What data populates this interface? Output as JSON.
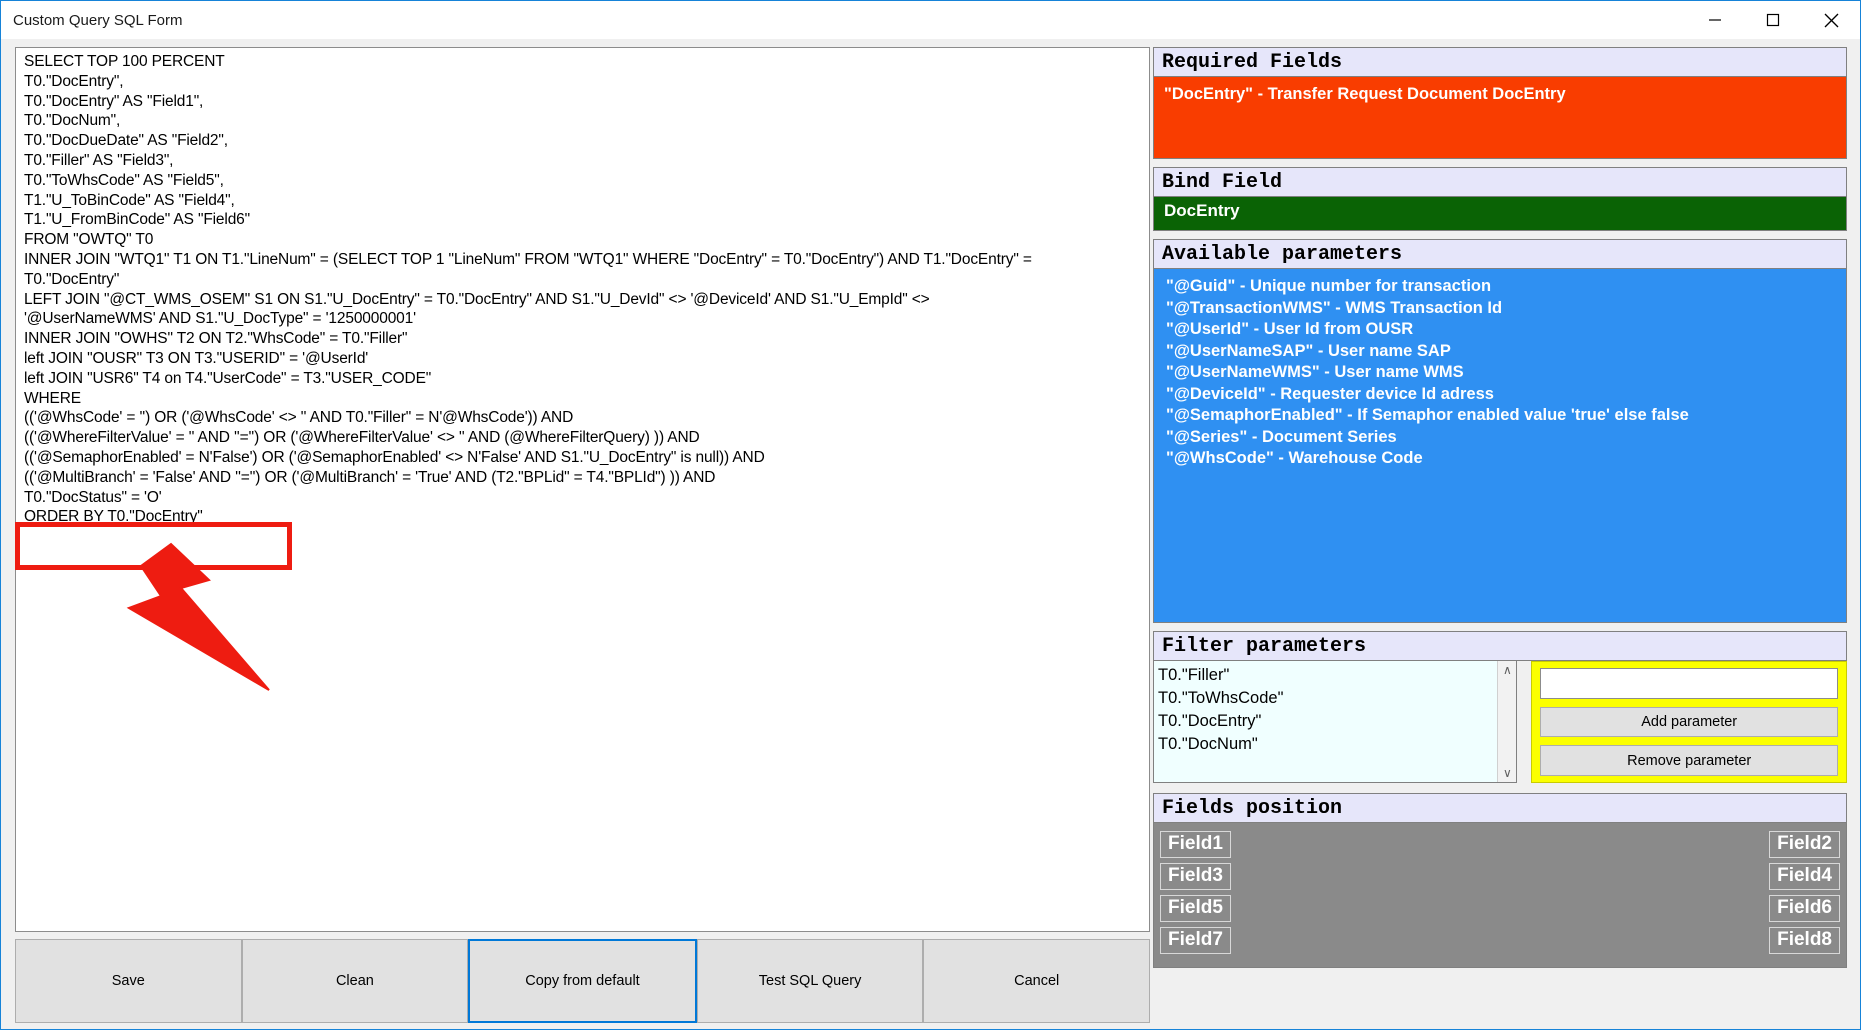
{
  "window": {
    "title": "Custom Query SQL Form",
    "controls": {
      "minimize": "minimize-button",
      "maximize": "maximize-button",
      "close": "close-button"
    }
  },
  "editor": {
    "sql": "SELECT TOP 100 PERCENT\nT0.\"DocEntry\",\nT0.\"DocEntry\" AS \"Field1\",\nT0.\"DocNum\",\nT0.\"DocDueDate\" AS \"Field2\",\nT0.\"Filler\" AS \"Field3\",\nT0.\"ToWhsCode\" AS \"Field5\",\nT1.\"U_ToBinCode\" AS \"Field4\",\nT1.\"U_FromBinCode\" AS \"Field6\"\nFROM \"OWTQ\" T0\nINNER JOIN \"WTQ1\" T1 ON T1.\"LineNum\" = (SELECT TOP 1 \"LineNum\" FROM \"WTQ1\" WHERE \"DocEntry\" = T0.\"DocEntry\") AND T1.\"DocEntry\" =\nT0.\"DocEntry\"\nLEFT JOIN \"@CT_WMS_OSEM\" S1 ON S1.\"U_DocEntry\" = T0.\"DocEntry\" AND S1.\"U_DevId\" <> '@DeviceId' AND S1.\"U_EmpId\" <>\n'@UserNameWMS' AND S1.\"U_DocType\" = '1250000001'\nINNER JOIN \"OWHS\" T2 ON T2.\"WhsCode\" = T0.\"Filler\"\nleft JOIN \"OUSR\" T3 ON T3.\"USERID\" = '@UserId'\nleft JOIN \"USR6\" T4 on T4.\"UserCode\" = T3.\"USER_CODE\"\nWHERE\n(('@WhsCode' = '') OR ('@WhsCode' <> '' AND T0.\"Filler\" = N'@WhsCode')) AND\n(('@WhereFilterValue' = '' AND ''='') OR ('@WhereFilterValue' <> '' AND (@WhereFilterQuery) )) AND\n(('@SemaphorEnabled' = N'False') OR ('@SemaphorEnabled' <> N'False' AND S1.\"U_DocEntry\" is null)) AND\n(('@MultiBranch' = 'False' AND ''='') OR ('@MultiBranch' = 'True' AND (T2.\"BPLid\" = T4.\"BPLId\") )) AND\nT0.\"DocStatus\" = 'O'\nORDER BY T0.\"DocEntry\""
  },
  "buttons": {
    "save": "Save",
    "clean": "Clean",
    "copy_from_default": "Copy from default",
    "test_sql_query": "Test SQL Query",
    "cancel": "Cancel"
  },
  "required_fields": {
    "header": "Required Fields",
    "items": [
      "\"DocEntry\" - Transfer Request Document DocEntry"
    ]
  },
  "bind_field": {
    "header": "Bind Field",
    "value": "DocEntry"
  },
  "available_parameters": {
    "header": "Available parameters",
    "items": [
      "\"@Guid\" - Unique number for transaction",
      "\"@TransactionWMS\" - WMS Transaction Id",
      "\"@UserId\" - User Id from OUSR",
      "\"@UserNameSAP\" - User name SAP",
      "\"@UserNameWMS\" - User name WMS",
      "\"@DeviceId\" - Requester device Id adress",
      "\"@SemaphorEnabled\" - If Semaphor enabled value 'true' else false",
      "\"@Series\" - Document Series",
      "\"@WhsCode\" - Warehouse Code"
    ]
  },
  "filter_parameters": {
    "header": "Filter parameters",
    "items": [
      "T0.\"Filler\"",
      "T0.\"ToWhsCode\"",
      "T0.\"DocEntry\"",
      "T0.\"DocNum\""
    ],
    "input_value": "",
    "input_placeholder": "",
    "add_button": "Add parameter",
    "remove_button": "Remove parameter",
    "scroll_up": "∧",
    "scroll_down": "∨"
  },
  "fields_position": {
    "header": "Fields position",
    "left_column": [
      "Field1",
      "Field3",
      "Field5",
      "Field7"
    ],
    "right_column": [
      "Field2",
      "Field4",
      "Field6",
      "Field8"
    ]
  },
  "colors": {
    "required_bg": "#f93d00",
    "bind_bg": "#0a6305",
    "params_bg": "#2f90f2",
    "filter_actions_bg": "#fbff00",
    "fields_bg": "#8a8a8a",
    "annotation": "#ee1c11",
    "focus_border": "#0078d7"
  }
}
